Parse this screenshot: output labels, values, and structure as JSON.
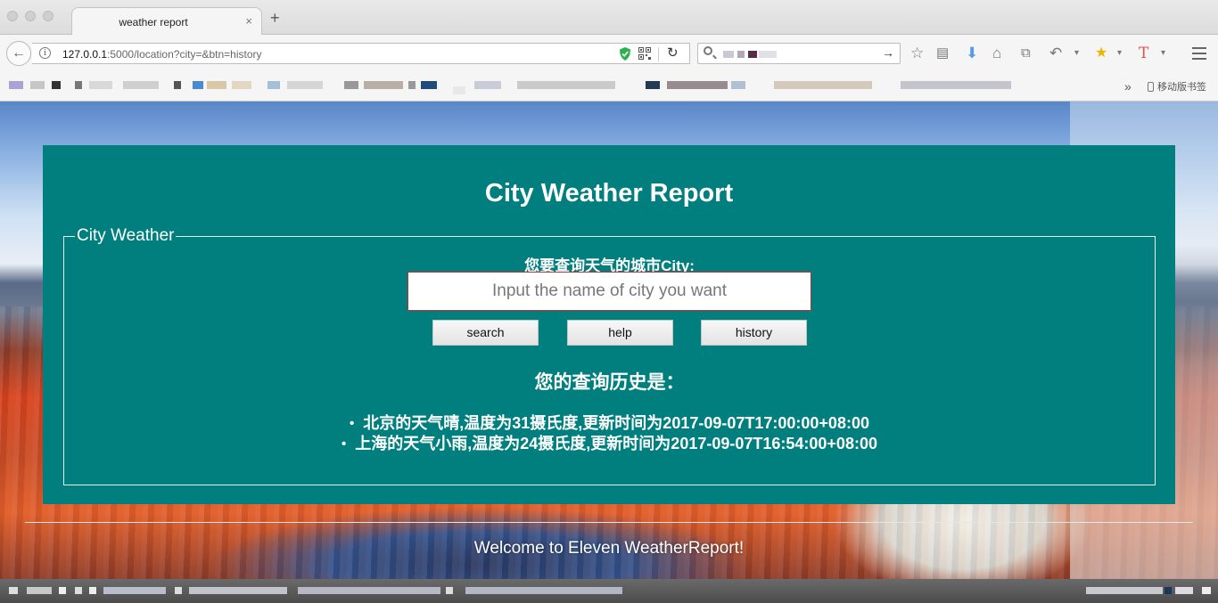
{
  "browser": {
    "tab_title": "weather report",
    "tab_close": "×",
    "new_tab": "+",
    "url_host": "127.0.0.1",
    "url_rest": ":5000/location?city=&btn=history",
    "reload": "↻",
    "back": "←",
    "search_go": "→",
    "toolbar_icons": [
      "star-icon",
      "reader-icon",
      "download-icon",
      "home-icon",
      "crop-icon",
      "undo-icon",
      "extension-icon",
      "text-icon",
      "menu-icon"
    ],
    "bookmarks_more": "»",
    "mobile_bookmarks": "移动版书签"
  },
  "page": {
    "title": "City Weather Report",
    "legend": "City Weather",
    "prompt": "您要查询天气的城市City:",
    "input_placeholder": "Input the name of city you want",
    "input_value": "",
    "buttons": {
      "search": "search",
      "help": "help",
      "history": "history"
    },
    "history_title": "您的查询历史是：",
    "history": [
      "北京的天气晴,温度为31摄氏度,更新时间为2017-09-07T17:00:00+08:00",
      "上海的天气小雨,温度为24摄氏度,更新时间为2017-09-07T16:54:00+08:00"
    ],
    "footer": "Welcome to Eleven WeatherReport!"
  },
  "colors": {
    "panel": "#007f7e",
    "text": "#ffffff",
    "input_border": "#bb3333"
  }
}
